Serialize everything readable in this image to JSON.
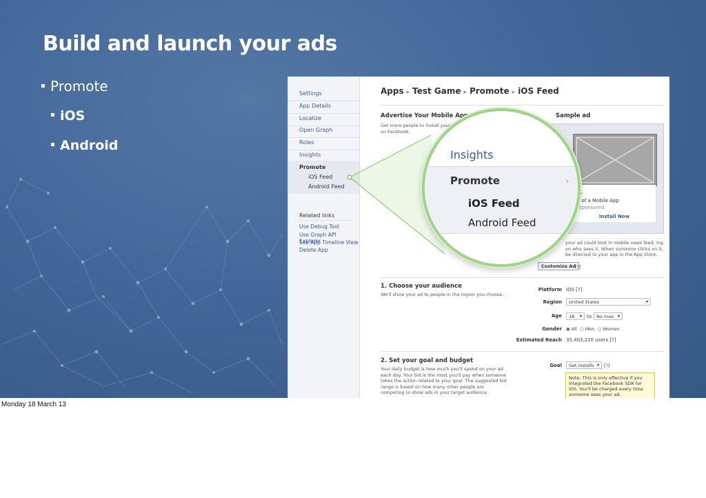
{
  "slide": {
    "title": "Build and launch your ads",
    "bullets": [
      "Promote",
      "iOS",
      "Android"
    ]
  },
  "sidebar": {
    "items": [
      "Settings",
      "App Details",
      "Localize",
      "Open Graph",
      "Roles",
      "Insights"
    ],
    "promote": "Promote",
    "sub_items": [
      "iOS Feed",
      "Android Feed"
    ],
    "related_heading": "Related links",
    "related_links": [
      "Use Debug Tool",
      "Use Graph API Explorer",
      "See App Timeline View",
      "Delete App"
    ]
  },
  "breadcrumb": [
    "Apps",
    "Test Game",
    "Promote",
    "iOS Feed"
  ],
  "advertise": {
    "heading": "Advertise Your Mobile App",
    "desc_line1": "Get more people to install your m",
    "desc_line2": "on Facebook.",
    "sample_heading": "Sample ad",
    "ad_line1": "ne",
    "ad_line2": "le of a Mobile App",
    "ad_sponsored": "· Sponsored",
    "install_now": "Install Now",
    "caption": "your ad could look in mobile news feed, ing on who sees it. When someone clicks on it, be directed to your app in the App Store.",
    "customize_button": "Customize Ad",
    "help": "[?]"
  },
  "audience": {
    "heading": "1. Choose your audience",
    "desc": "We'll show your ad to people in the region you choose.",
    "platform_label": "Platform",
    "platform_value": "iOS [?]",
    "region_label": "Region",
    "region_value": "United States",
    "age_label": "Age",
    "age_min": "18",
    "age_to": "to",
    "age_max": "No max",
    "gender_label": "Gender",
    "gender_options": [
      "All",
      "Men",
      "Women"
    ],
    "reach_label": "Estimated Reach",
    "reach_value": "35,403,220 users [?]"
  },
  "budget": {
    "heading": "2. Set your goal and budget",
    "desc": "Your daily budget is how much you'll spend on your ad each day. Your bid is the most you'll pay when someone takes the action related to your goal. The suggested bid range is based on how many other people are competing to show ads in your target audience.",
    "goal_label": "Goal",
    "goal_value": "Get installs",
    "help": "[?]",
    "note": "Note: This is only effective if you integrated the Facebook SDK for iOS. You'll be charged every time someone sees your ad."
  },
  "magnifier": {
    "insights": "Insights",
    "promote": "Promote",
    "ios_feed": "iOS Feed",
    "android_feed": "Android Feed"
  },
  "footer": "Monday 18 March 13"
}
